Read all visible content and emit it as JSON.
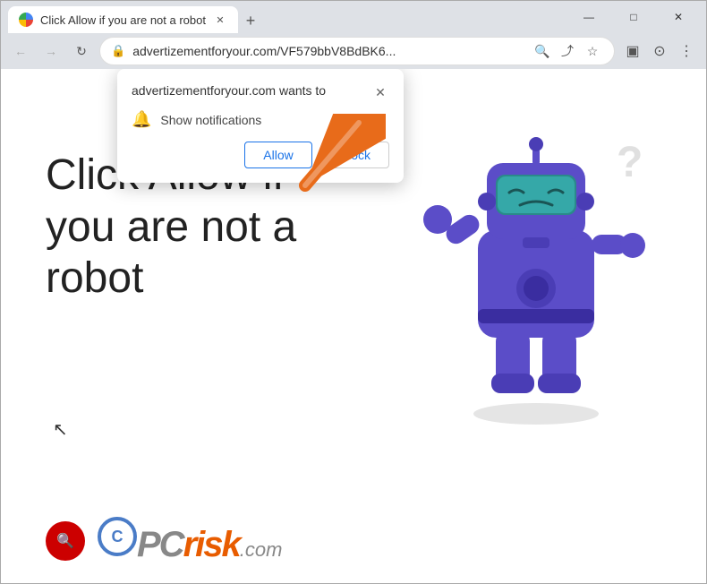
{
  "window": {
    "title": "Click Allow if you are not a robot",
    "controls": {
      "minimize": "—",
      "maximize": "□",
      "close": "✕"
    }
  },
  "tab": {
    "label": "Click Allow if you are not a robot",
    "close": "✕",
    "new_tab": "+"
  },
  "addressbar": {
    "back": "←",
    "forward": "→",
    "refresh": "↻",
    "url": "advertizementforyour.com/VF579bbV8BdBK6...",
    "url_full": "advertizementforyour.com/VF579bbV8BdBK6...",
    "search_icon": "🔍",
    "share_icon": "⤴",
    "star_icon": "☆",
    "extensions_icon": "▣",
    "profile_icon": "⊙",
    "menu_icon": "⋮"
  },
  "popup": {
    "title": "advertizementforyour.com wants to",
    "close": "✕",
    "notification_label": "Show notifications",
    "allow_btn": "Allow",
    "block_btn": "Block"
  },
  "webpage": {
    "heading": "Click Allow if you are not a robot"
  },
  "pcrisk": {
    "text": "PC",
    "risk": "risk",
    "dotcom": ".com"
  },
  "colors": {
    "accent": "#1a73e8",
    "robot_body": "#5b4dc8",
    "robot_head": "#4a3db5",
    "arrow": "#e86b1a"
  }
}
